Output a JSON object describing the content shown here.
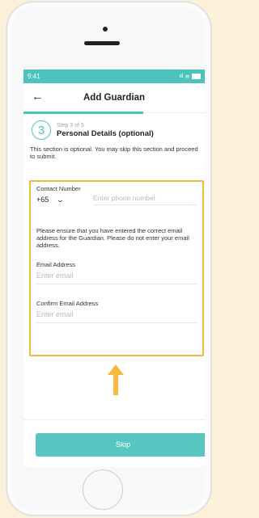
{
  "status_bar": {
    "time": "9:41",
    "signal": "ııl",
    "wifi": "≋"
  },
  "header": {
    "title": "Add Guardian",
    "back_icon": "back-arrow-icon"
  },
  "step": {
    "number": "3",
    "counter": "Step 3 of 5",
    "title": "Personal Details (optional)",
    "progress_fraction": 0.6
  },
  "intro_text": "This section is optional. You may skip this section and proceed to submit.",
  "contact": {
    "label": "Contact Number",
    "country_code": "+65",
    "phone_placeholder": "Enter phone number"
  },
  "notice_text": "Please ensure that you have entered the correct email address for the Guardian. Please do not enter your email address.",
  "email": {
    "label": "Email Address",
    "placeholder": "Enter email"
  },
  "confirm_email": {
    "label": "Confirm Email Address",
    "placeholder": "Enter email"
  },
  "actions": {
    "skip_label": "Skip"
  },
  "colors": {
    "accent": "#4ec3bd",
    "highlight": "#f5b840",
    "background": "#fdf0d8"
  }
}
